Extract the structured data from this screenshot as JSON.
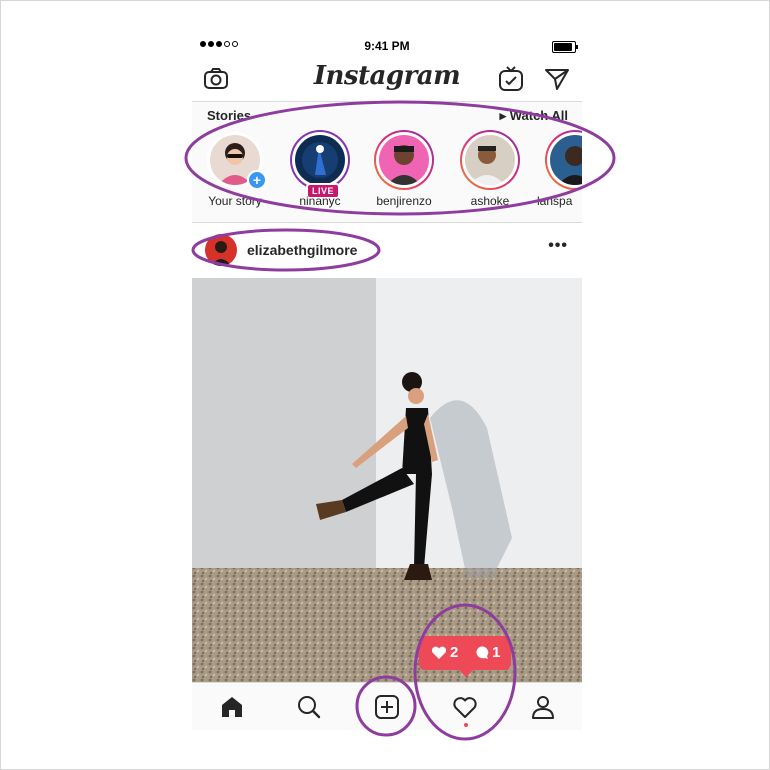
{
  "status_bar": {
    "time": "9:41 PM"
  },
  "header": {
    "title": "Instagram"
  },
  "stories": {
    "title": "Stories",
    "watch_all": "▸ Watch All",
    "items": [
      {
        "name": "Your story"
      },
      {
        "name": "ninanyc",
        "badge": "LIVE"
      },
      {
        "name": "benjirenzo"
      },
      {
        "name": "ashoke"
      },
      {
        "name": "lanspa"
      }
    ]
  },
  "post": {
    "username": "elizabethgilmore",
    "more": "•••"
  },
  "notification": {
    "likes": "2",
    "comments": "1"
  },
  "colors": {
    "accent": "#ed4956",
    "live": "#c7166c",
    "annotation": "#8e3d9e",
    "link": "#3897f0"
  },
  "icons": [
    "camera-icon",
    "igtv-icon",
    "direct-icon",
    "home-icon",
    "search-icon",
    "new-post-icon",
    "activity-heart-icon",
    "profile-icon"
  ]
}
